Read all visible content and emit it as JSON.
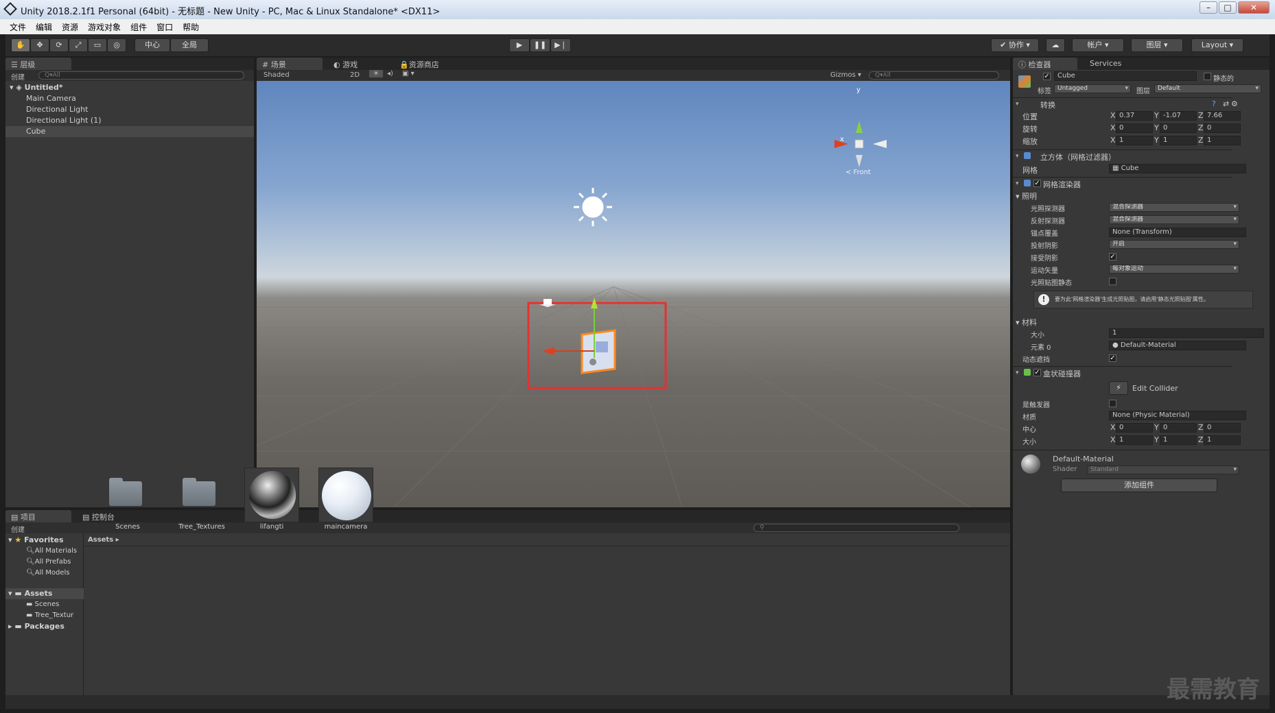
{
  "window": {
    "title": "Unity 2018.2.1f1 Personal (64bit) - 无标题 - New Unity - PC, Mac & Linux Standalone* <DX11>"
  },
  "menu": [
    "文件",
    "编辑",
    "资源",
    "游戏对象",
    "组件",
    "窗口",
    "帮助"
  ],
  "toolbar": {
    "pivot": "中心",
    "global": "全局",
    "collab": "协作",
    "account": "帐户",
    "layers": "图层",
    "layout": "Layout"
  },
  "hierarchy": {
    "tab": "层级",
    "create": "创建",
    "search": "Q▾All",
    "scene": "Untitled*",
    "items": [
      "Main Camera",
      "Directional Light",
      "Directional Light (1)",
      "Cube"
    ],
    "selected": "Cube"
  },
  "scene": {
    "tabs": [
      "场景",
      "游戏",
      "资源商店"
    ],
    "shading": "Shaded",
    "mode2d": "2D",
    "gizmos": "Gizmos",
    "search": "Q▾All",
    "view_label": "< Front",
    "axis_x": "x",
    "axis_y": "y"
  },
  "inspector": {
    "tabs": [
      "检查器",
      "Services"
    ],
    "object_name": "Cube",
    "static_label": "静态的",
    "tag_label": "标签",
    "tag_value": "Untagged",
    "layer_label": "图层",
    "layer_value": "Default",
    "transform": {
      "title": "转换",
      "position_label": "位置",
      "px": "0.37",
      "py": "-1.07",
      "pz": "7.66",
      "rotation_label": "旋转",
      "rx": "0",
      "ry": "0",
      "rz": "0",
      "scale_label": "缩放",
      "sx": "1",
      "sy": "1",
      "sz": "1"
    },
    "mesh_filter": {
      "title": "立方体（网格过滤器）",
      "mesh_label": "网格",
      "mesh_value": "Cube"
    },
    "mesh_renderer": {
      "title": "网格渲染器",
      "lighting": "照明",
      "light_probes_label": "光照探测器",
      "light_probes_value": "混合探测器",
      "reflection_probes_label": "反射探测器",
      "reflection_probes_value": "混合探测器",
      "anchor_label": "锚点覆盖",
      "anchor_value": "None (Transform)",
      "cast_shadows_label": "投射阴影",
      "cast_shadows_value": "开启",
      "receive_shadows_label": "接受阴影",
      "motion_vectors_label": "运动矢量",
      "motion_vectors_value": "每对象运动",
      "lightmap_static_label": "光照贴图静态",
      "info": "要为此'网格渲染器'生成光照贴图，请启用'静态光照贴图'属性。",
      "materials": "材料",
      "size_label": "大小",
      "size_value": "1",
      "element0_label": "元素 0",
      "element0_value": "Default-Material",
      "dynamic_occlusion_label": "动态遮挡"
    },
    "box_collider": {
      "title": "盒状碰撞器",
      "edit_collider": "Edit Collider",
      "trigger_label": "是触发器",
      "material_label": "材质",
      "material_value": "None (Physic Material)",
      "center_label": "中心",
      "cx": "0",
      "cy": "0",
      "cz": "0",
      "size_label": "大小",
      "sx": "1",
      "sy": "1",
      "sz": "1"
    },
    "material": {
      "name": "Default-Material",
      "shader_label": "Shader",
      "shader_value": "Standard"
    },
    "add_component": "添加组件"
  },
  "project": {
    "tabs": [
      "项目",
      "控制台"
    ],
    "create": "创建",
    "favorites": "Favorites",
    "fav_items": [
      "All Materials",
      "All Prefabs",
      "All Models"
    ],
    "assets": "Assets",
    "asset_folders": [
      "Scenes",
      "Tree_Textur"
    ],
    "packages": "Packages",
    "breadcrumb": "Assets ▸",
    "items": [
      "Scenes",
      "Tree_Textures",
      "lifangti",
      "maincamera"
    ]
  },
  "watermark": "最需教育"
}
